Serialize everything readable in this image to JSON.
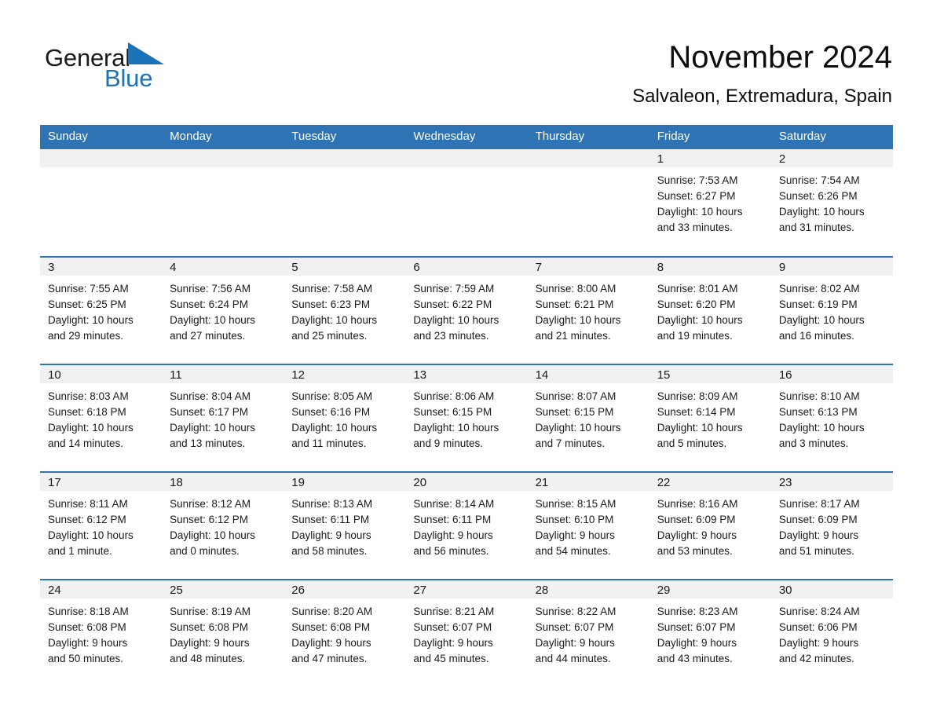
{
  "brand": {
    "name_part1": "General",
    "name_part2": "Blue",
    "triangle_color": "#1a72b8",
    "text_color": "#18191b"
  },
  "header": {
    "title": "November 2024",
    "subtitle": "Salvaleon, Extremadura, Spain"
  },
  "colors": {
    "header_blue": "#2e74b5",
    "daynum_strip": "#f1f1f1",
    "text": "#1a1a1a",
    "page_background": "#ffffff"
  },
  "calendar": {
    "weekday_headers": [
      "Sunday",
      "Monday",
      "Tuesday",
      "Wednesday",
      "Thursday",
      "Friday",
      "Saturday"
    ],
    "weeks": [
      [
        {
          "day": "",
          "sunrise": "",
          "sunset": "",
          "daylight_line1": "",
          "daylight_line2": ""
        },
        {
          "day": "",
          "sunrise": "",
          "sunset": "",
          "daylight_line1": "",
          "daylight_line2": ""
        },
        {
          "day": "",
          "sunrise": "",
          "sunset": "",
          "daylight_line1": "",
          "daylight_line2": ""
        },
        {
          "day": "",
          "sunrise": "",
          "sunset": "",
          "daylight_line1": "",
          "daylight_line2": ""
        },
        {
          "day": "",
          "sunrise": "",
          "sunset": "",
          "daylight_line1": "",
          "daylight_line2": ""
        },
        {
          "day": "1",
          "sunrise": "Sunrise: 7:53 AM",
          "sunset": "Sunset: 6:27 PM",
          "daylight_line1": "Daylight: 10 hours",
          "daylight_line2": "and 33 minutes."
        },
        {
          "day": "2",
          "sunrise": "Sunrise: 7:54 AM",
          "sunset": "Sunset: 6:26 PM",
          "daylight_line1": "Daylight: 10 hours",
          "daylight_line2": "and 31 minutes."
        }
      ],
      [
        {
          "day": "3",
          "sunrise": "Sunrise: 7:55 AM",
          "sunset": "Sunset: 6:25 PM",
          "daylight_line1": "Daylight: 10 hours",
          "daylight_line2": "and 29 minutes."
        },
        {
          "day": "4",
          "sunrise": "Sunrise: 7:56 AM",
          "sunset": "Sunset: 6:24 PM",
          "daylight_line1": "Daylight: 10 hours",
          "daylight_line2": "and 27 minutes."
        },
        {
          "day": "5",
          "sunrise": "Sunrise: 7:58 AM",
          "sunset": "Sunset: 6:23 PM",
          "daylight_line1": "Daylight: 10 hours",
          "daylight_line2": "and 25 minutes."
        },
        {
          "day": "6",
          "sunrise": "Sunrise: 7:59 AM",
          "sunset": "Sunset: 6:22 PM",
          "daylight_line1": "Daylight: 10 hours",
          "daylight_line2": "and 23 minutes."
        },
        {
          "day": "7",
          "sunrise": "Sunrise: 8:00 AM",
          "sunset": "Sunset: 6:21 PM",
          "daylight_line1": "Daylight: 10 hours",
          "daylight_line2": "and 21 minutes."
        },
        {
          "day": "8",
          "sunrise": "Sunrise: 8:01 AM",
          "sunset": "Sunset: 6:20 PM",
          "daylight_line1": "Daylight: 10 hours",
          "daylight_line2": "and 19 minutes."
        },
        {
          "day": "9",
          "sunrise": "Sunrise: 8:02 AM",
          "sunset": "Sunset: 6:19 PM",
          "daylight_line1": "Daylight: 10 hours",
          "daylight_line2": "and 16 minutes."
        }
      ],
      [
        {
          "day": "10",
          "sunrise": "Sunrise: 8:03 AM",
          "sunset": "Sunset: 6:18 PM",
          "daylight_line1": "Daylight: 10 hours",
          "daylight_line2": "and 14 minutes."
        },
        {
          "day": "11",
          "sunrise": "Sunrise: 8:04 AM",
          "sunset": "Sunset: 6:17 PM",
          "daylight_line1": "Daylight: 10 hours",
          "daylight_line2": "and 13 minutes."
        },
        {
          "day": "12",
          "sunrise": "Sunrise: 8:05 AM",
          "sunset": "Sunset: 6:16 PM",
          "daylight_line1": "Daylight: 10 hours",
          "daylight_line2": "and 11 minutes."
        },
        {
          "day": "13",
          "sunrise": "Sunrise: 8:06 AM",
          "sunset": "Sunset: 6:15 PM",
          "daylight_line1": "Daylight: 10 hours",
          "daylight_line2": "and 9 minutes."
        },
        {
          "day": "14",
          "sunrise": "Sunrise: 8:07 AM",
          "sunset": "Sunset: 6:15 PM",
          "daylight_line1": "Daylight: 10 hours",
          "daylight_line2": "and 7 minutes."
        },
        {
          "day": "15",
          "sunrise": "Sunrise: 8:09 AM",
          "sunset": "Sunset: 6:14 PM",
          "daylight_line1": "Daylight: 10 hours",
          "daylight_line2": "and 5 minutes."
        },
        {
          "day": "16",
          "sunrise": "Sunrise: 8:10 AM",
          "sunset": "Sunset: 6:13 PM",
          "daylight_line1": "Daylight: 10 hours",
          "daylight_line2": "and 3 minutes."
        }
      ],
      [
        {
          "day": "17",
          "sunrise": "Sunrise: 8:11 AM",
          "sunset": "Sunset: 6:12 PM",
          "daylight_line1": "Daylight: 10 hours",
          "daylight_line2": "and 1 minute."
        },
        {
          "day": "18",
          "sunrise": "Sunrise: 8:12 AM",
          "sunset": "Sunset: 6:12 PM",
          "daylight_line1": "Daylight: 10 hours",
          "daylight_line2": "and 0 minutes."
        },
        {
          "day": "19",
          "sunrise": "Sunrise: 8:13 AM",
          "sunset": "Sunset: 6:11 PM",
          "daylight_line1": "Daylight: 9 hours",
          "daylight_line2": "and 58 minutes."
        },
        {
          "day": "20",
          "sunrise": "Sunrise: 8:14 AM",
          "sunset": "Sunset: 6:11 PM",
          "daylight_line1": "Daylight: 9 hours",
          "daylight_line2": "and 56 minutes."
        },
        {
          "day": "21",
          "sunrise": "Sunrise: 8:15 AM",
          "sunset": "Sunset: 6:10 PM",
          "daylight_line1": "Daylight: 9 hours",
          "daylight_line2": "and 54 minutes."
        },
        {
          "day": "22",
          "sunrise": "Sunrise: 8:16 AM",
          "sunset": "Sunset: 6:09 PM",
          "daylight_line1": "Daylight: 9 hours",
          "daylight_line2": "and 53 minutes."
        },
        {
          "day": "23",
          "sunrise": "Sunrise: 8:17 AM",
          "sunset": "Sunset: 6:09 PM",
          "daylight_line1": "Daylight: 9 hours",
          "daylight_line2": "and 51 minutes."
        }
      ],
      [
        {
          "day": "24",
          "sunrise": "Sunrise: 8:18 AM",
          "sunset": "Sunset: 6:08 PM",
          "daylight_line1": "Daylight: 9 hours",
          "daylight_line2": "and 50 minutes."
        },
        {
          "day": "25",
          "sunrise": "Sunrise: 8:19 AM",
          "sunset": "Sunset: 6:08 PM",
          "daylight_line1": "Daylight: 9 hours",
          "daylight_line2": "and 48 minutes."
        },
        {
          "day": "26",
          "sunrise": "Sunrise: 8:20 AM",
          "sunset": "Sunset: 6:08 PM",
          "daylight_line1": "Daylight: 9 hours",
          "daylight_line2": "and 47 minutes."
        },
        {
          "day": "27",
          "sunrise": "Sunrise: 8:21 AM",
          "sunset": "Sunset: 6:07 PM",
          "daylight_line1": "Daylight: 9 hours",
          "daylight_line2": "and 45 minutes."
        },
        {
          "day": "28",
          "sunrise": "Sunrise: 8:22 AM",
          "sunset": "Sunset: 6:07 PM",
          "daylight_line1": "Daylight: 9 hours",
          "daylight_line2": "and 44 minutes."
        },
        {
          "day": "29",
          "sunrise": "Sunrise: 8:23 AM",
          "sunset": "Sunset: 6:07 PM",
          "daylight_line1": "Daylight: 9 hours",
          "daylight_line2": "and 43 minutes."
        },
        {
          "day": "30",
          "sunrise": "Sunrise: 8:24 AM",
          "sunset": "Sunset: 6:06 PM",
          "daylight_line1": "Daylight: 9 hours",
          "daylight_line2": "and 42 minutes."
        }
      ]
    ]
  }
}
